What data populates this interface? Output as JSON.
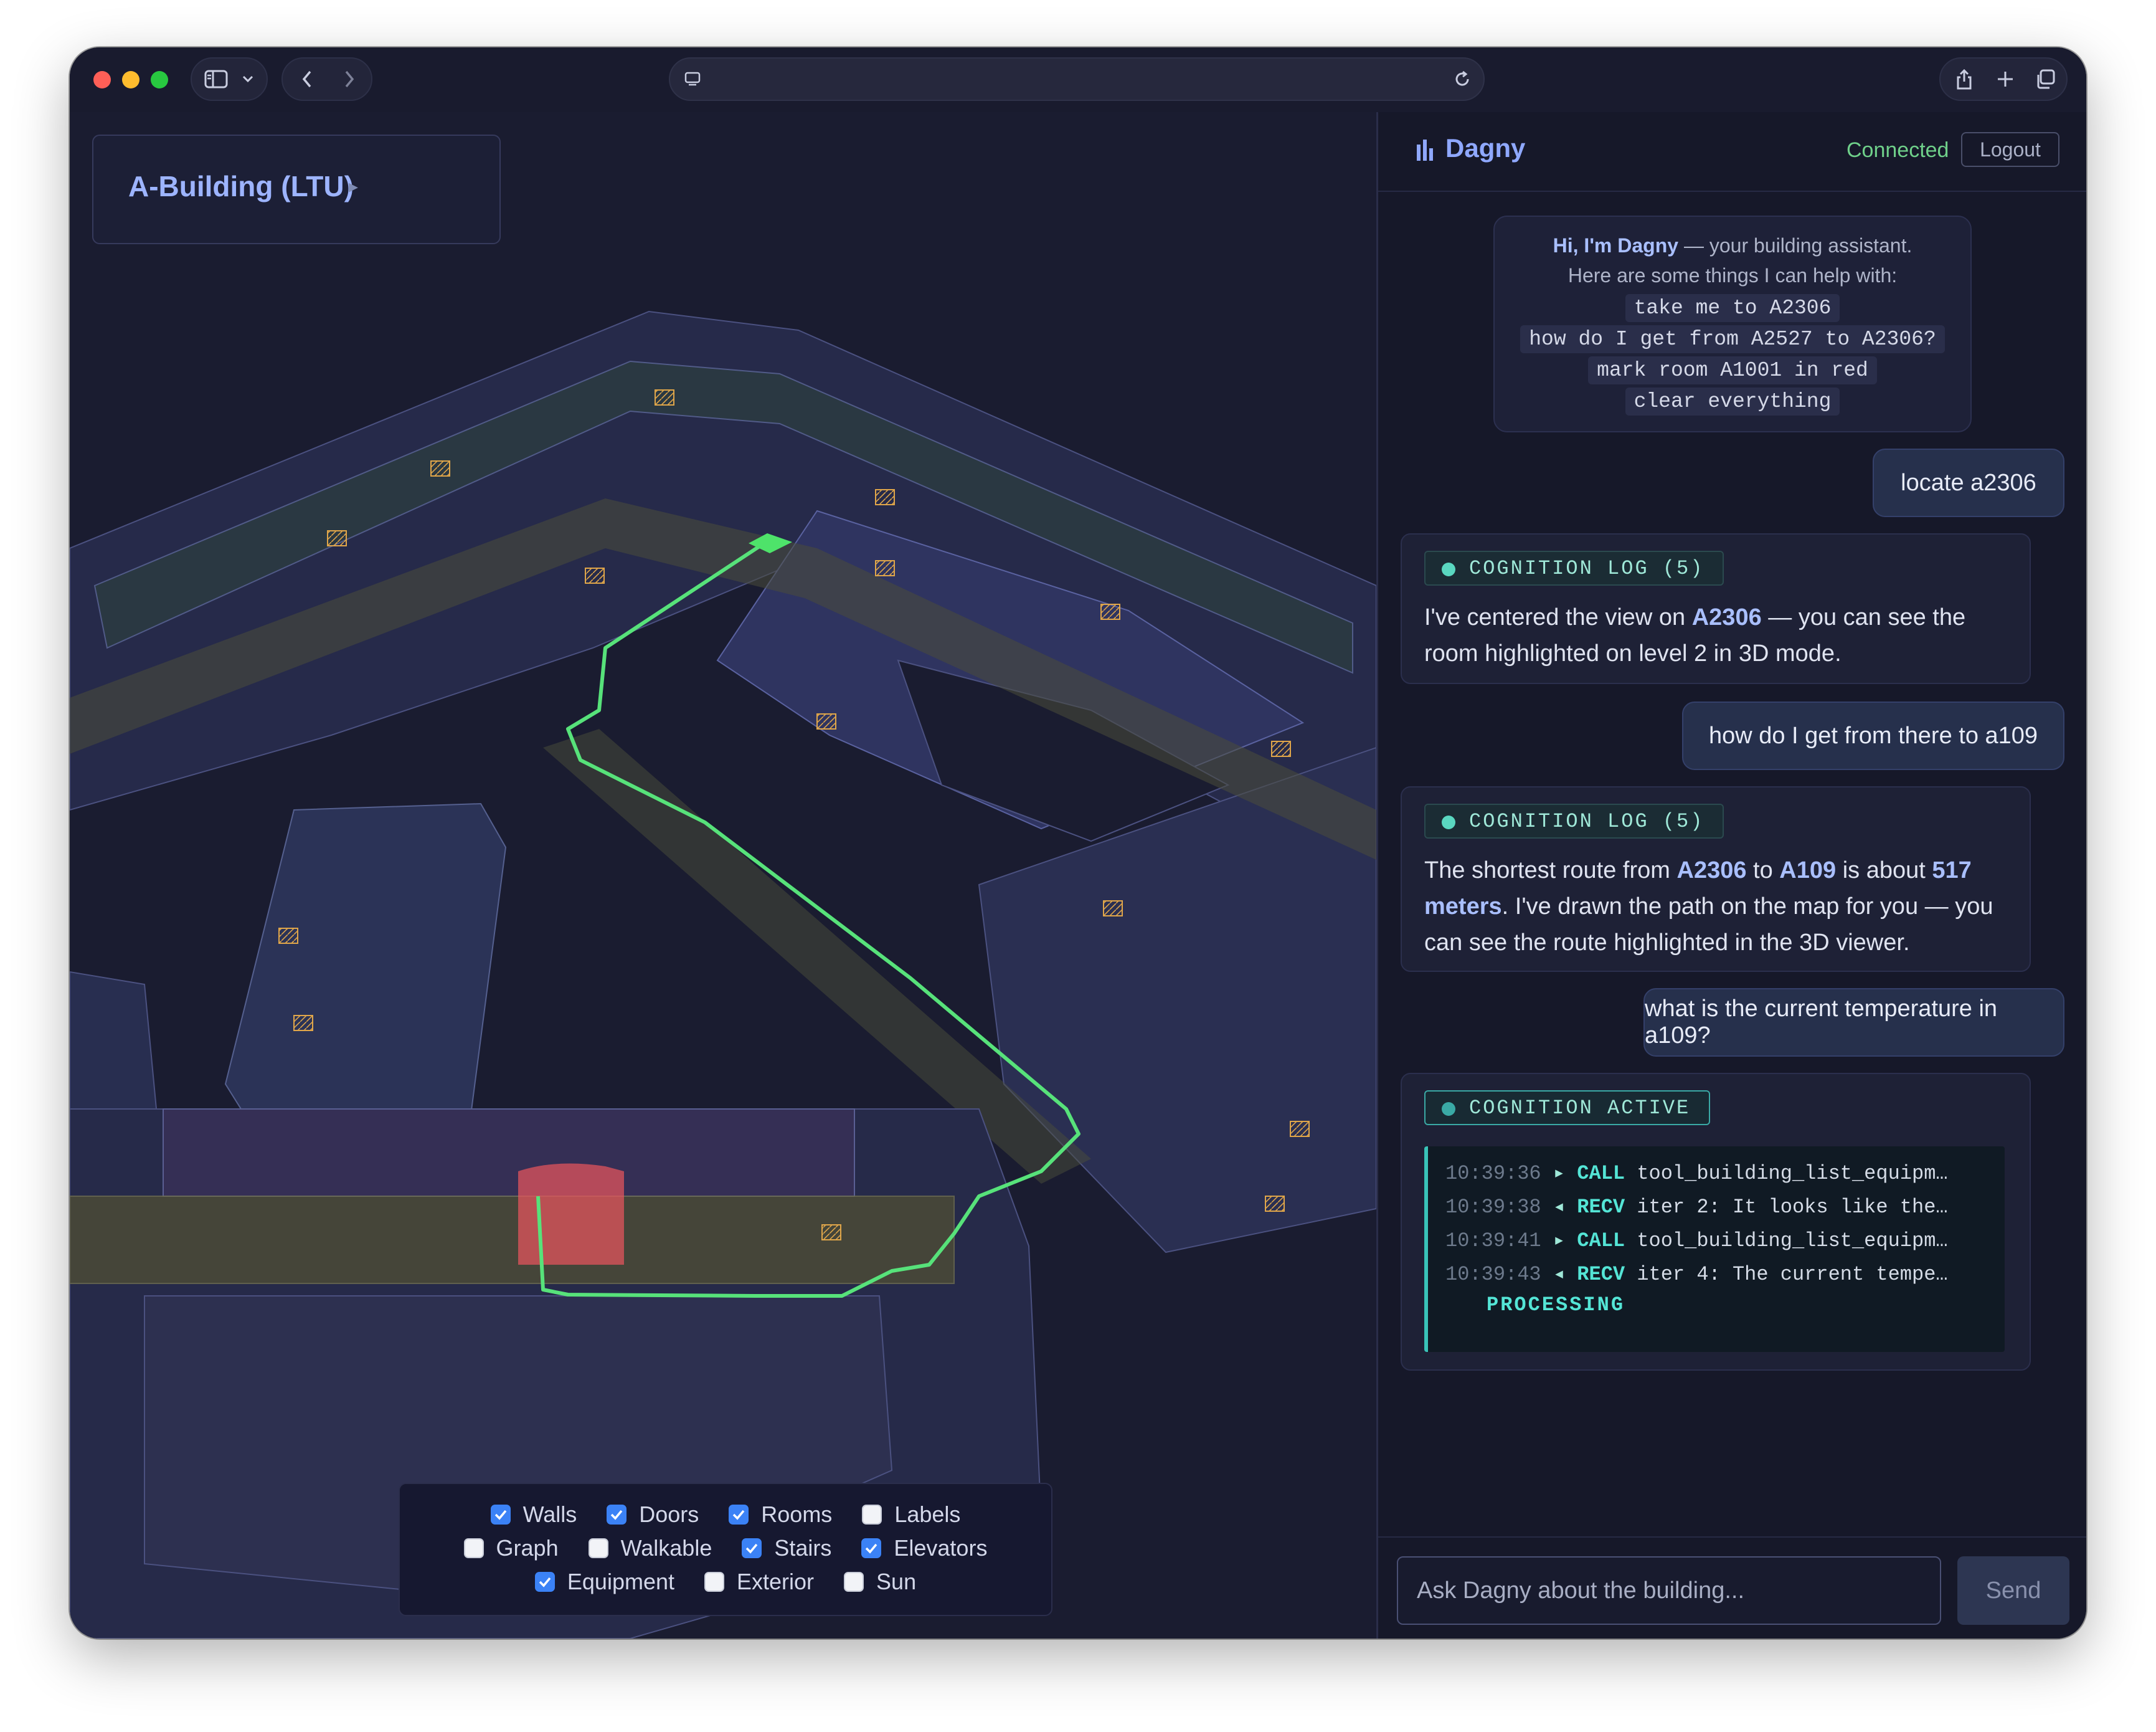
{
  "browser": {
    "address_text": "",
    "icons": [
      "sidebar-icon",
      "chevron-down-icon",
      "back-icon",
      "forward-icon",
      "page-icon",
      "reload-icon",
      "share-icon",
      "plus-icon",
      "tabs-icon"
    ]
  },
  "viewer": {
    "building_title": "A-Building (LTU)",
    "building_arrow": "▸",
    "layers": [
      {
        "label": "Walls",
        "checked": true
      },
      {
        "label": "Doors",
        "checked": true
      },
      {
        "label": "Rooms",
        "checked": true
      },
      {
        "label": "Labels",
        "checked": false
      },
      {
        "label": "Graph",
        "checked": false
      },
      {
        "label": "Walkable",
        "checked": false
      },
      {
        "label": "Stairs",
        "checked": true
      },
      {
        "label": "Elevators",
        "checked": true
      },
      {
        "label": "Equipment",
        "checked": true
      },
      {
        "label": "Exterior",
        "checked": false
      },
      {
        "label": "Sun",
        "checked": false
      }
    ],
    "colors": {
      "route": "#57e27a",
      "highlight_room": "#e8555d",
      "start_marker": "#4ee36a",
      "equipment": "#e0a64a"
    }
  },
  "chat": {
    "assistant_name": "Dagny",
    "status": "Connected",
    "logout_label": "Logout",
    "welcome": {
      "greeting_bold": "Hi, I'm Dagny",
      "greeting_rest": " — your building assistant.",
      "intro": "Here are some things I can help with:",
      "examples": [
        "take me to A2306",
        "how do I get from A2527 to A2306?",
        "mark room A1001 in red",
        "clear everything"
      ]
    },
    "messages": [
      {
        "role": "user",
        "text": "locate a2306"
      },
      {
        "role": "assistant",
        "badge": "COGNITION LOG (5)",
        "line1_pre": "I've centered the view on ",
        "line1_bold": "A2306",
        "line1_post": " — you can see the",
        "line2": "room highlighted on level 2 in 3D mode."
      },
      {
        "role": "user",
        "text": "how do I get from there to a109"
      },
      {
        "role": "assistant",
        "badge": "COGNITION LOG (5)",
        "l1_a": "The shortest route from ",
        "l1_b": "A2306",
        "l1_c": " to ",
        "l1_d": "A109",
        "l1_e": " is about ",
        "l1_f": "517",
        "l2_a": "meters",
        "l2_b": ". I've drawn the path on the map for you — you",
        "l3": "can see the route highlighted in the 3D viewer."
      },
      {
        "role": "user",
        "text": "what is the current temperature in a109?"
      },
      {
        "role": "assistant",
        "badge": "COGNITION ACTIVE",
        "log": [
          {
            "time": "10:39:36",
            "arrow": "▸",
            "kind": "CALL",
            "text": "tool_building_list_equipm…"
          },
          {
            "time": "10:39:38",
            "arrow": "◂",
            "kind": "RECV",
            "text": "iter 2: It looks like the…"
          },
          {
            "time": "10:39:41",
            "arrow": "▸",
            "kind": "CALL",
            "text": "tool_building_list_equipm…"
          },
          {
            "time": "10:39:43",
            "arrow": "◂",
            "kind": "RECV",
            "text": "iter 4: The current tempe…"
          }
        ],
        "status": "PROCESSING"
      }
    ],
    "input_placeholder": "Ask Dagny about the building...",
    "send_label": "Send"
  }
}
